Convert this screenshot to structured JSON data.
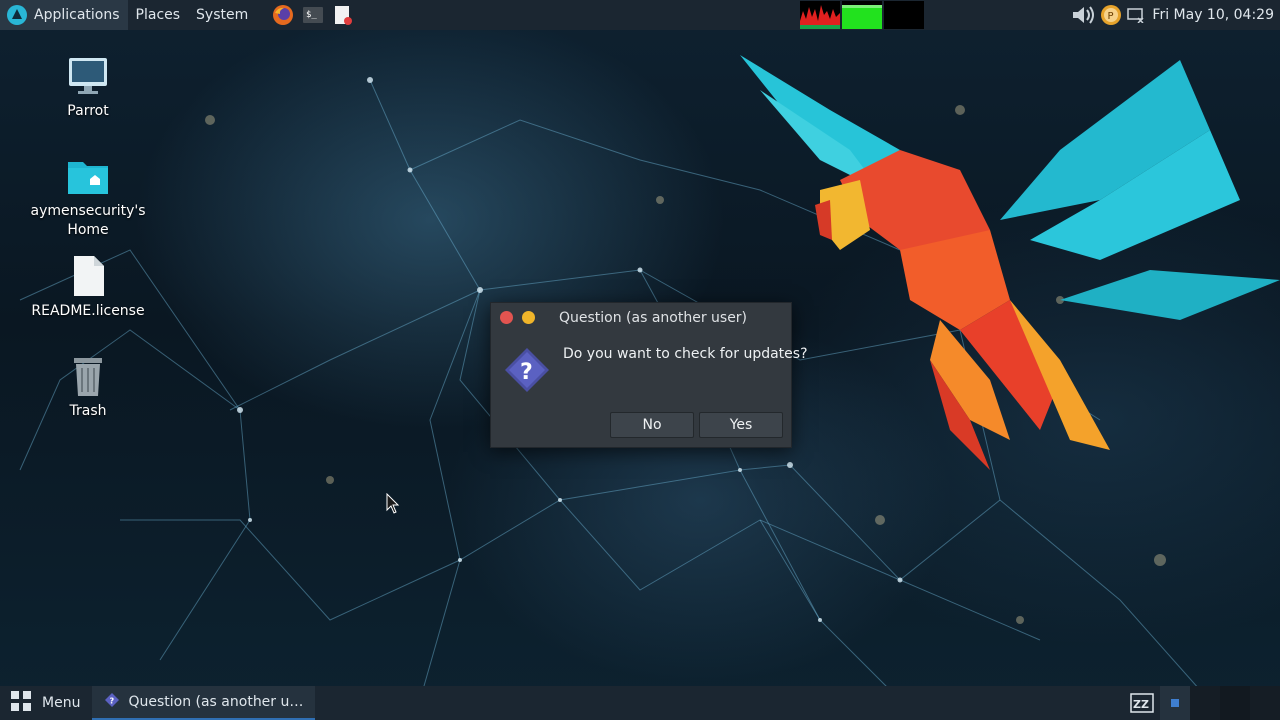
{
  "top_panel": {
    "menus": [
      "Applications",
      "Places",
      "System"
    ],
    "launchers": [
      "firefox-icon",
      "terminal-icon",
      "text-editor-icon"
    ],
    "clock": "Fri May 10, 04:29"
  },
  "desktop": {
    "icons": [
      {
        "label": "Parrot",
        "icon": "computer-icon"
      },
      {
        "label": "aymensecurity's Home",
        "icon": "home-folder-icon"
      },
      {
        "label": "README.license",
        "icon": "file-icon"
      },
      {
        "label": "Trash",
        "icon": "trash-icon"
      }
    ]
  },
  "dialog": {
    "title": "Question (as another user)",
    "message": "Do you want to check for updates?",
    "no_label": "No",
    "yes_label": "Yes",
    "icon": "question-icon"
  },
  "bottom_panel": {
    "menu_label": "Menu",
    "task_label": "Question (as another u…"
  },
  "colors": {
    "panel_bg": "#1b2631",
    "dialog_bg": "#33393f",
    "accent": "#2f6fb3",
    "close": "#e25450",
    "minimize": "#f0b52a"
  }
}
